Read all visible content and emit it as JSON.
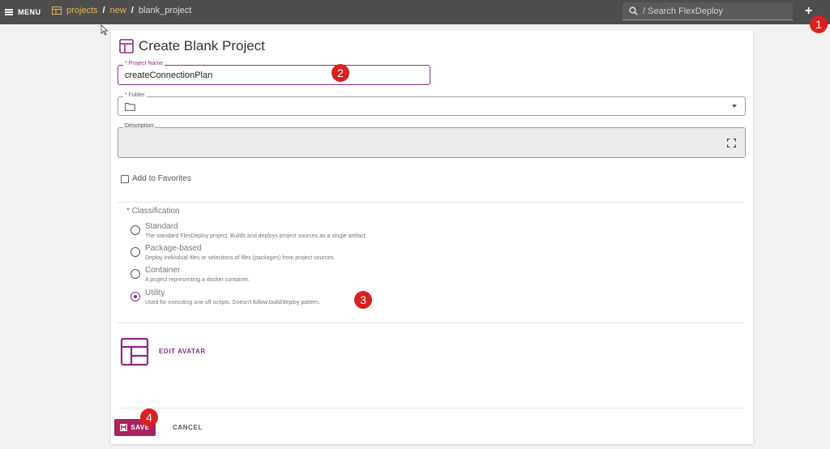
{
  "topbar": {
    "menu_label": "MENU",
    "breadcrumbs": [
      "projects",
      "new",
      "blank_project"
    ],
    "separator": "/",
    "search_placeholder": "/ Search FlexDeploy",
    "plus_label": "+"
  },
  "badges": [
    "1",
    "2",
    "3",
    "4"
  ],
  "form": {
    "title": "Create Blank Project",
    "project_name_label": "* Project Name",
    "project_name_value": "createConnectionPlan",
    "folder_label": "* Folder",
    "description_label": "Description",
    "favorites_label": "Add to Favorites",
    "classification_label": "* Classification",
    "options": [
      {
        "title": "Standard",
        "desc": "The standard FlexDeploy project. Builds and deploys project sources as a single artifact.",
        "selected": false
      },
      {
        "title": "Package-based",
        "desc": "Deploy individual files or selections of files (packages) from project sources.",
        "selected": false
      },
      {
        "title": "Container",
        "desc": "A project representing a docker container.",
        "selected": false
      },
      {
        "title": "Utility",
        "desc": "Used for executing one off scripts. Doesn't follow build/deploy pattern.",
        "selected": true
      }
    ],
    "edit_avatar_label": "EDIT AVATAR",
    "save_label": "SAVE",
    "cancel_label": "CANCEL"
  },
  "colors": {
    "accent": "#8e2a86",
    "save": "#a8235f",
    "breadcrumb_link": "#e0b64d",
    "topbar": "#4e4e4e",
    "badge": "#d9211f"
  }
}
